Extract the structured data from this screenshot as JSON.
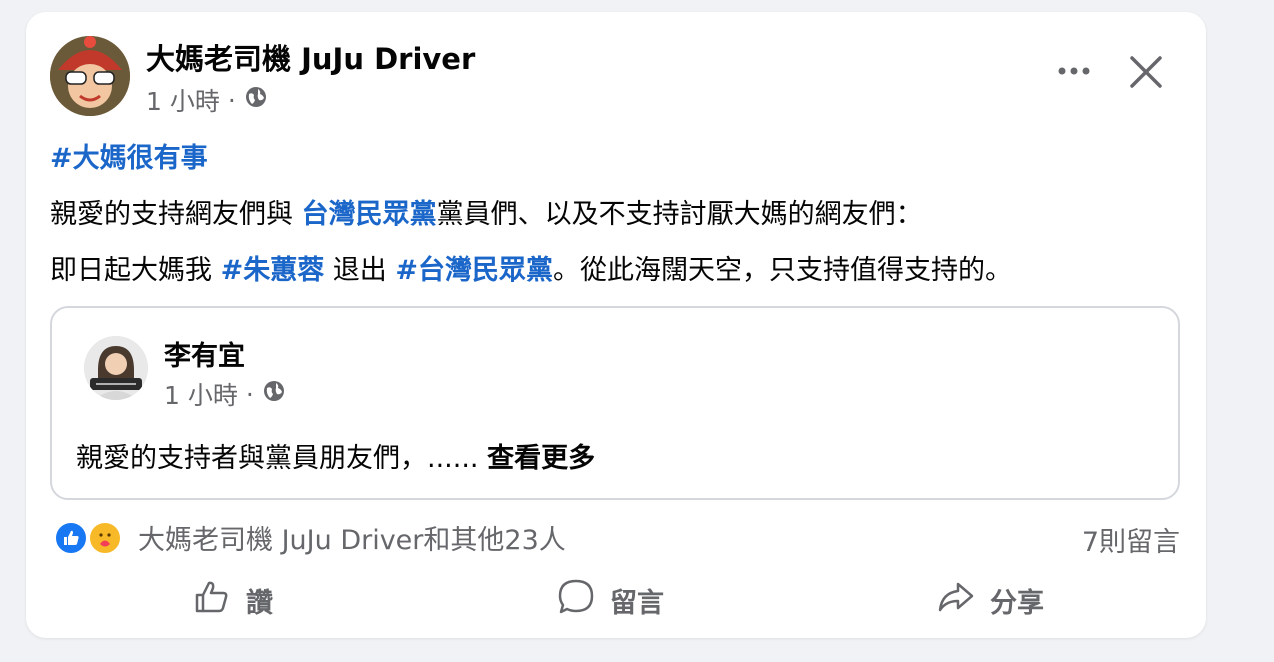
{
  "post": {
    "author": "大媽老司機 JuJu Driver",
    "time": "1 小時",
    "dot": "·",
    "hashtag": "#大媽很有事",
    "line1_a": "親愛的支持網友們與 ",
    "line1_tag": "台灣民眾黨",
    "line1_b": "黨員們、以及不支持討厭大媽的網友們：",
    "line2_a": "即日起大媽我 ",
    "line2_tag1": "#朱蕙蓉",
    "line2_b": " 退出 ",
    "line2_tag2": "#台灣民眾黨",
    "line2_c": "。從此海闊天空，只支持值得支持的。"
  },
  "shared": {
    "author": "李有宜",
    "time": "1 小時",
    "dot": "·",
    "text": "親愛的支持者與黨員朋友們，...... ",
    "see_more": "查看更多"
  },
  "footer": {
    "reactions_text": "大媽老司機 JuJu Driver和其他23人",
    "comments": "7則留言"
  },
  "actions": {
    "like": "讚",
    "comment": "留言",
    "share": "分享"
  },
  "icons": {
    "more": "more-dots-icon",
    "close": "close-icon",
    "globe": "globe-icon",
    "like_reaction": "like-reaction-icon",
    "care_reaction": "care-reaction-icon",
    "like_action": "thumbs-up-icon",
    "comment_action": "speech-bubble-icon",
    "share_action": "share-arrow-icon"
  },
  "colors": {
    "link": "#1b66c9",
    "muted": "#65676b",
    "text": "#050505",
    "like_blue": "#1877f2"
  }
}
